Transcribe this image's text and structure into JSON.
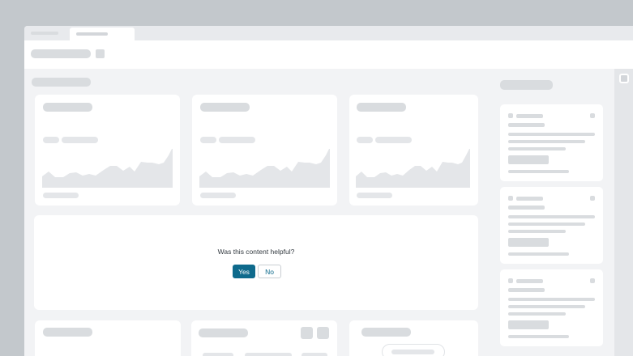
{
  "feedback": {
    "question": "Was this content helpful?",
    "yes_label": "Yes",
    "no_label": "No"
  },
  "colors": {
    "accent": "#0e6a8c",
    "placeholder": "#d9dcdf",
    "background": "#f2f3f5"
  }
}
